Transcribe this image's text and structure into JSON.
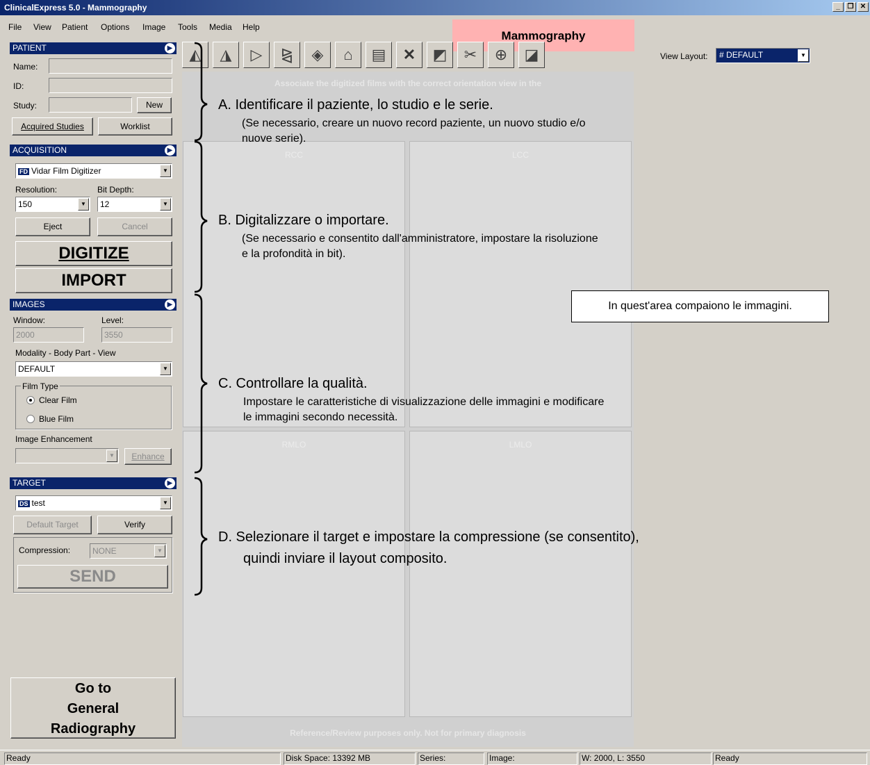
{
  "window": {
    "title": "ClinicalExpress 5.0 - Mammography"
  },
  "menu": [
    "File",
    "View",
    "Patient",
    "Options",
    "Image",
    "Tools",
    "Media",
    "Help"
  ],
  "mode_label": "Mammography",
  "patient": {
    "header": "PATIENT",
    "name_label": "Name:",
    "id_label": "ID:",
    "study_label": "Study:",
    "new_button": "New",
    "acquired_button": "Acquired Studies",
    "worklist_button": "Worklist"
  },
  "acquisition": {
    "header": "ACQUISITION",
    "device_badge": "FD",
    "device": "Vidar Film Digitizer",
    "resolution_label": "Resolution:",
    "resolution_value": "150",
    "bitdepth_label": "Bit Depth:",
    "bitdepth_value": "12",
    "eject_button": "Eject",
    "cancel_button": "Cancel",
    "digitize_button": "DIGITIZE",
    "import_button": "IMPORT"
  },
  "images": {
    "header": "IMAGES",
    "window_label": "Window:",
    "window_value": "2000",
    "level_label": "Level:",
    "level_value": "3550",
    "modality_label": "Modality - Body Part - View",
    "modality_value": "DEFAULT",
    "film_type_label": "Film Type",
    "clear_film": "Clear Film",
    "blue_film": "Blue Film",
    "enhancement_label": "Image Enhancement",
    "enhance_button": "Enhance"
  },
  "target": {
    "header": "TARGET",
    "target_badge": "DS",
    "target_value": "test",
    "default_target_button": "Default Target",
    "verify_button": "Verify",
    "compression_label": "Compression:",
    "compression_value": "NONE",
    "send_button": "SEND"
  },
  "goto_button": {
    "line1": "Go to",
    "line2": "General",
    "line3": "Radiography"
  },
  "view_layout": {
    "label": "View Layout:",
    "value": "DEFAULT"
  },
  "image_area": {
    "assoc_text": "Associate the digitized films with the correct orientation view in the",
    "reference_text": "Reference/Review purposes only. Not for primary diagnosis",
    "views": [
      "RCC",
      "LCC",
      "RMLO",
      "LMLO"
    ]
  },
  "annotations": {
    "a_title": "A. Identificare il paziente, lo studio e le serie.",
    "a_sub1": "(Se necessario, creare un nuovo record paziente, un nuovo studio e/o",
    "a_sub2": "nuove serie).",
    "b_title": "B. Digitalizzare o importare.",
    "b_sub1": "(Se necessario e consentito dall'amministratore, impostare la risoluzione",
    "b_sub2": "e la profondità in bit).",
    "c_title": "C. Controllare la qualità.",
    "c_sub1": "Impostare le caratteristiche di visualizzazione delle immagini e modificare",
    "c_sub2": "le immagini secondo necessità.",
    "d_title1": "D. Selezionare il target e impostare la compressione (se consentito),",
    "d_title2": "quindi inviare il layout composito.",
    "callout": "In quest'area compaiono le immagini."
  },
  "status": {
    "left": "Ready",
    "disk": "Disk Space: 13392 MB",
    "series": "Series:",
    "image": "Image:",
    "wl": "W: 2000, L: 3550",
    "right": "Ready"
  }
}
